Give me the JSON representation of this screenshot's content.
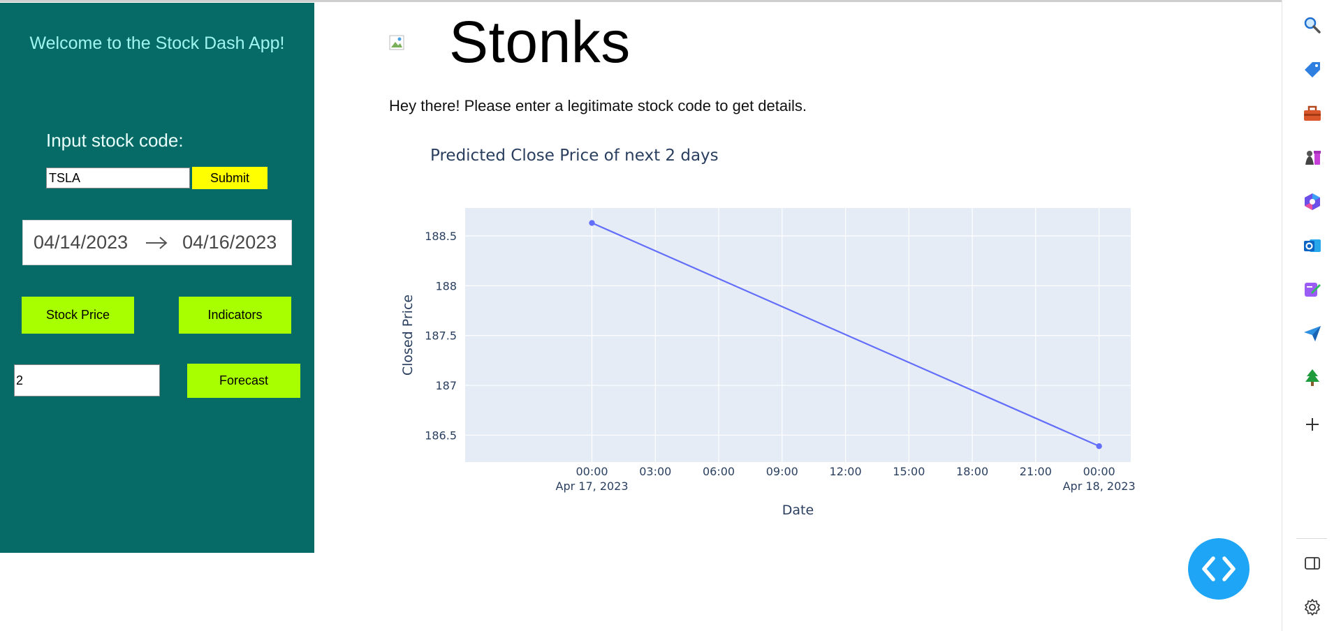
{
  "sidebar": {
    "welcome": "Welcome to the Stock Dash App!",
    "input_label": "Input stock code:",
    "stock_code_value": "TSLA",
    "submit_label": "Submit",
    "start_date": "04/14/2023",
    "end_date": "04/16/2023",
    "stock_price_label": "Stock Price",
    "indicators_label": "Indicators",
    "days_value": "2",
    "forecast_label": "Forecast",
    "colors": {
      "bg": "#066a66",
      "submit": "#ffff00",
      "buttons": "#a8ff00"
    }
  },
  "main": {
    "title": "Stonks",
    "description": "Hey there! Please enter a legitimate stock code to get details."
  },
  "chart_data": {
    "type": "line",
    "title": "Predicted Close Price of next 2 days",
    "xlabel": "Date",
    "ylabel": "Closed Price",
    "x": [
      "2023-04-17 00:00",
      "2023-04-18 00:00"
    ],
    "y": [
      188.63,
      186.39
    ],
    "x_range": [
      "2023-04-16 18:00",
      "2023-04-18 01:30"
    ],
    "y_range": [
      186.23,
      188.78
    ],
    "x_ticks": [
      {
        "time": "00:00",
        "date": "Apr 17, 2023"
      },
      {
        "time": "03:00",
        "date": ""
      },
      {
        "time": "06:00",
        "date": ""
      },
      {
        "time": "09:00",
        "date": ""
      },
      {
        "time": "12:00",
        "date": ""
      },
      {
        "time": "15:00",
        "date": ""
      },
      {
        "time": "18:00",
        "date": ""
      },
      {
        "time": "21:00",
        "date": ""
      },
      {
        "time": "00:00",
        "date": "Apr 18, 2023"
      }
    ],
    "y_ticks": [
      "188.5",
      "188",
      "187.5",
      "187",
      "186.5"
    ],
    "grid": true,
    "line_color": "#636efa",
    "plot_bg": "#e5ecf6"
  },
  "edge_sidebar": {
    "icons": [
      "search-icon",
      "tag-icon",
      "toolbox-icon",
      "chess-icon",
      "copilot-icon",
      "outlook-icon",
      "designer-icon",
      "send-icon",
      "tree-icon",
      "plus-icon"
    ],
    "bottom_icons": [
      "sidebar-toggle-icon",
      "settings-icon"
    ]
  },
  "fab": {
    "icon": "code-icon",
    "color": "#1ea5f5"
  }
}
